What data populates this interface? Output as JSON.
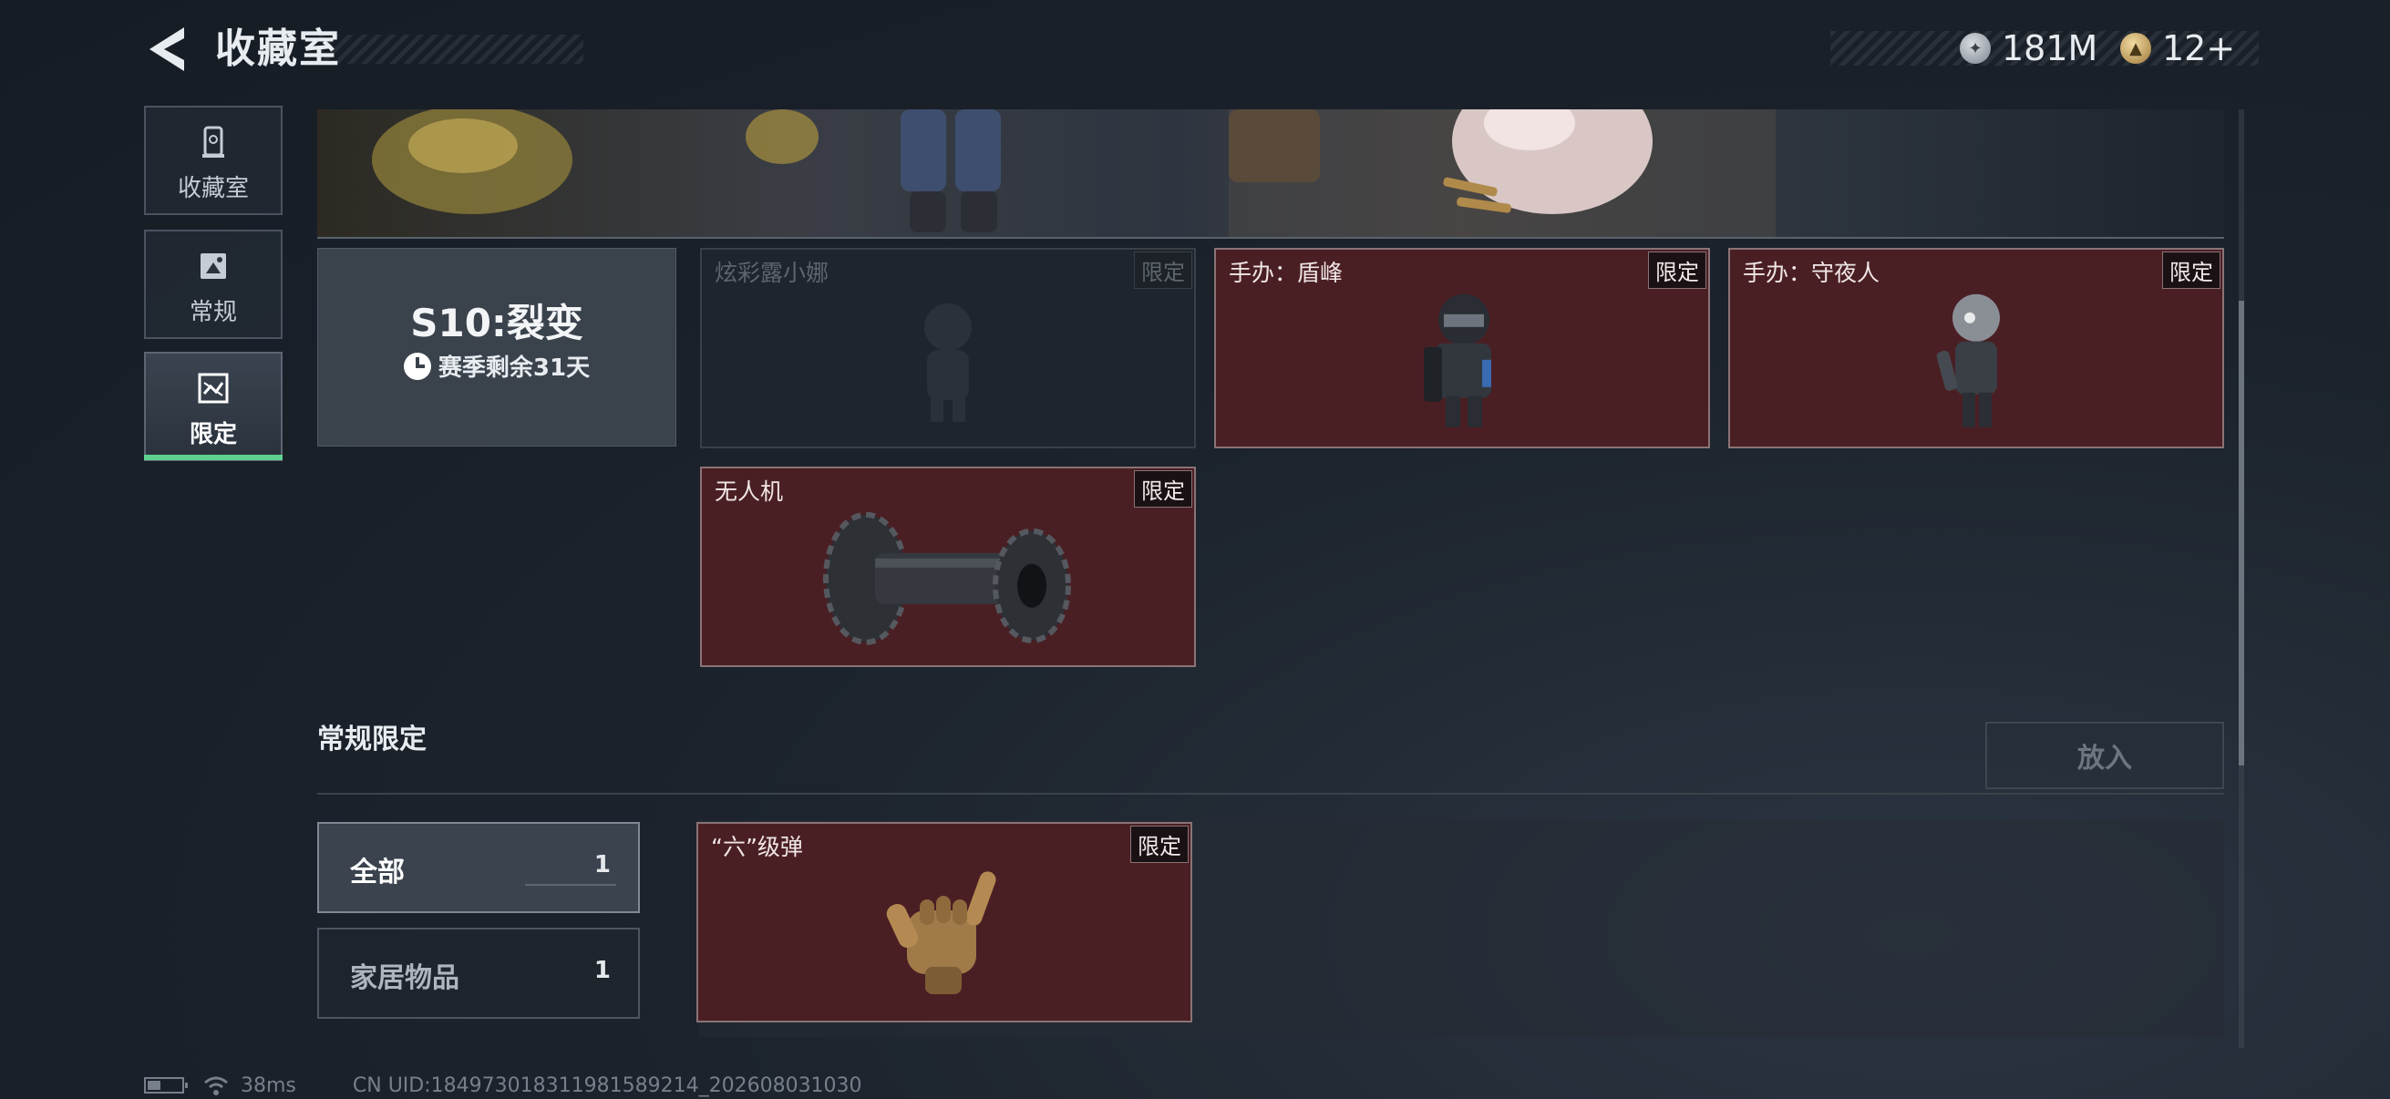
{
  "header": {
    "title": "收藏室",
    "currencies": [
      {
        "icon": "silver-coin-icon",
        "value": "181M"
      },
      {
        "icon": "gold-token-icon",
        "value": "12+"
      }
    ]
  },
  "nav": {
    "items": [
      {
        "label": "收藏室",
        "icon": "collection-icon",
        "active": false
      },
      {
        "label": "常规",
        "icon": "image-frame-icon",
        "active": false
      },
      {
        "label": "限定",
        "icon": "limited-icon",
        "active": true
      }
    ]
  },
  "season": {
    "name": "S10:裂变",
    "remaining": "赛季剩余31天"
  },
  "limited_items": [
    {
      "name": "炫彩露小娜",
      "badge": "限定",
      "owned": false
    },
    {
      "name": "手办：盾峰",
      "badge": "限定",
      "owned": true
    },
    {
      "name": "手办：守夜人",
      "badge": "限定",
      "owned": true
    },
    {
      "name": "无人机",
      "badge": "限定",
      "owned": true
    }
  ],
  "regular_limited": {
    "title": "常规限定",
    "put_button": "放入",
    "filters": [
      {
        "label": "全部",
        "count": "1",
        "active": true
      },
      {
        "label": "家居物品",
        "count": "1",
        "active": false
      }
    ],
    "items": [
      {
        "name": "“六”级弹",
        "badge": "限定"
      }
    ]
  },
  "status_bar": {
    "ping": "38ms",
    "uid": "CN UID:184973018311981589214_202608031030"
  },
  "colors": {
    "accent_green": "#5fd08f",
    "card_red": "#4a1f24",
    "background": "#1c232c"
  }
}
